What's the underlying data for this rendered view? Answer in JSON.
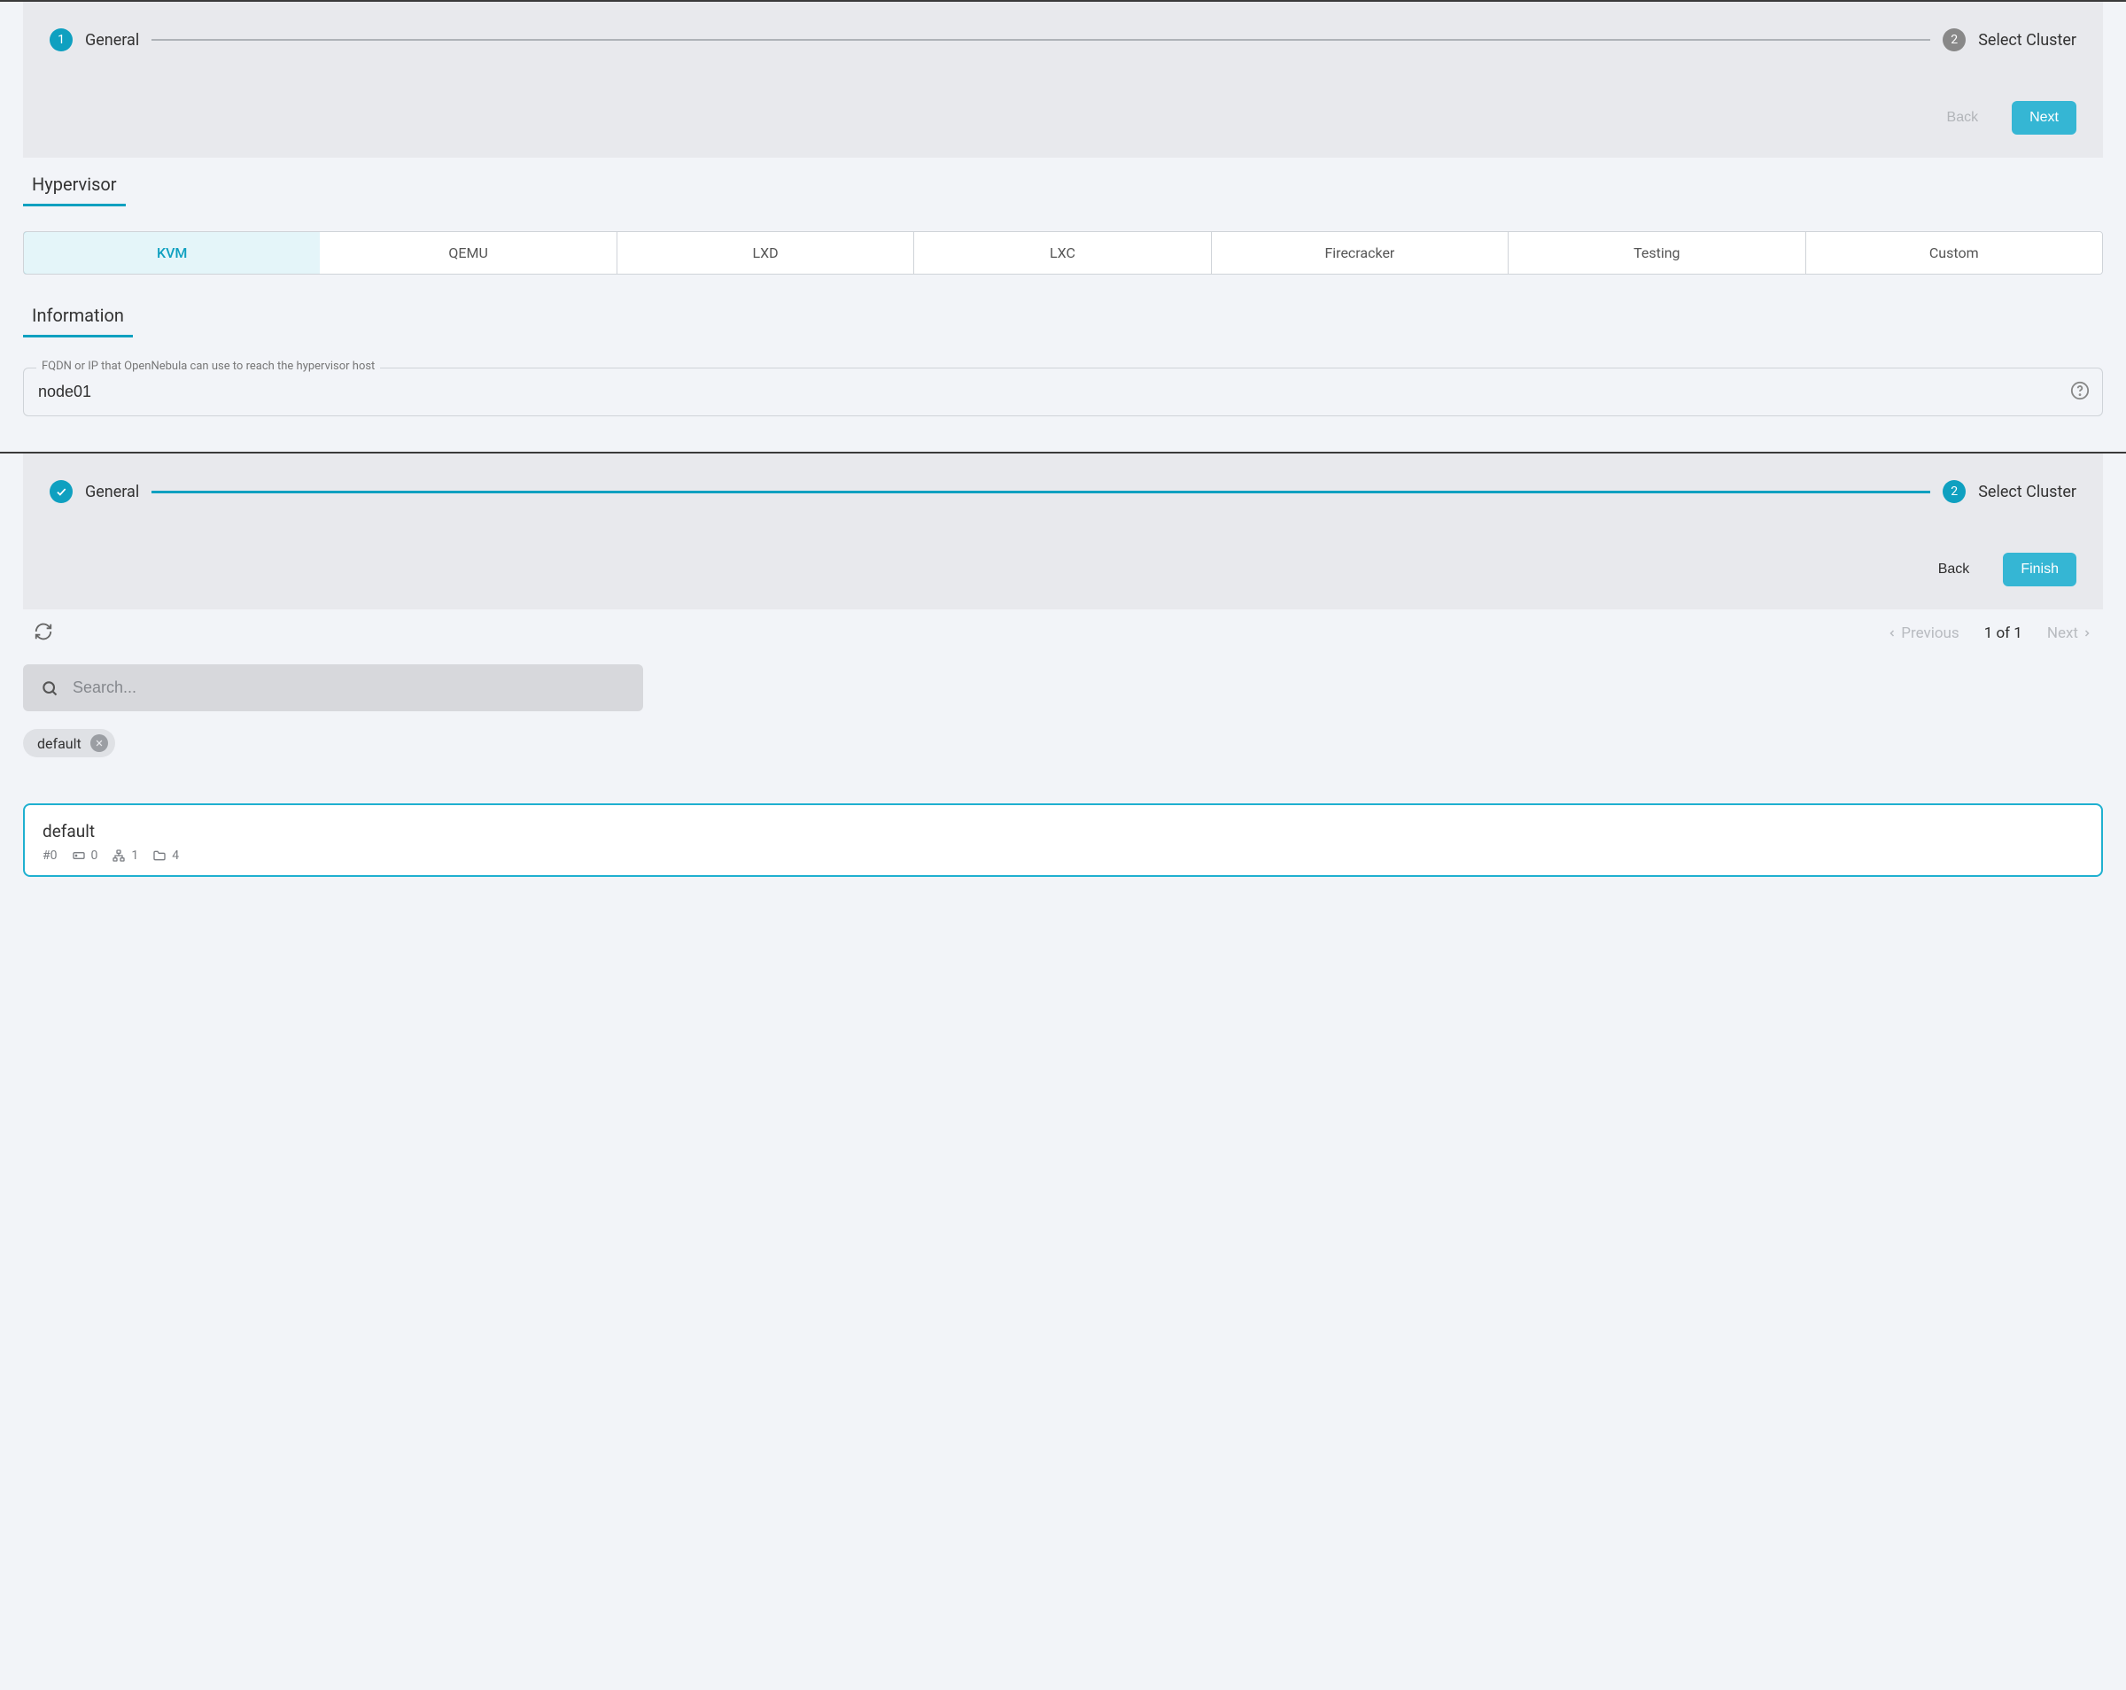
{
  "step1": {
    "steps": [
      {
        "num": "1",
        "label": "General",
        "state": "active"
      },
      {
        "num": "2",
        "label": "Select Cluster",
        "state": "inactive"
      }
    ],
    "back": "Back",
    "next": "Next",
    "hypervisorSection": "Hypervisor",
    "tabs": [
      "KVM",
      "QEMU",
      "LXD",
      "LXC",
      "Firecracker",
      "Testing",
      "Custom"
    ],
    "activeTab": 0,
    "infoSection": "Information",
    "fieldLegend": "FQDN or IP that OpenNebula can use to reach the hypervisor host",
    "fieldValue": "node01"
  },
  "step2": {
    "steps": [
      {
        "num": "1",
        "label": "General",
        "state": "done"
      },
      {
        "num": "2",
        "label": "Select Cluster",
        "state": "active"
      }
    ],
    "back": "Back",
    "finish": "Finish",
    "previous": "Previous",
    "next": "Next",
    "pageInfo": "1 of 1",
    "searchPlaceholder": "Search...",
    "chip": "default",
    "cluster": {
      "name": "default",
      "id": "#0",
      "disks": "0",
      "networks": "1",
      "folders": "4"
    }
  }
}
